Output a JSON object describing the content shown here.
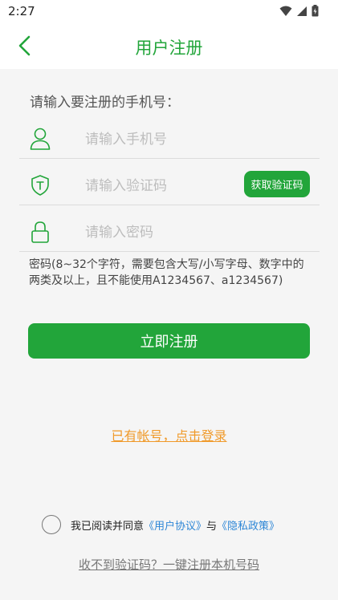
{
  "status_bar": {
    "time": "2:27"
  },
  "header": {
    "title": "用户注册"
  },
  "form": {
    "prompt": "请输入要注册的手机号：",
    "phone": {
      "placeholder": "请输入手机号",
      "value": ""
    },
    "code": {
      "placeholder": "请输入验证码",
      "value": "",
      "button_label": "获取验证码"
    },
    "password": {
      "placeholder": "请输入密码",
      "value": ""
    },
    "password_hint": "密码(8~32个字符，需要包含大写/小写字母、数字中的两类及以上，且不能使用A1234567、a1234567)",
    "register_label": "立即注册"
  },
  "login_link": "已有帐号，点击登录",
  "agreement": {
    "prefix": "我已阅读并同意",
    "user_agreement": "《用户协议》",
    "and": "与",
    "privacy_policy": "《隐私政策》"
  },
  "one_click_register": "收不到验证码？一键注册本机号码",
  "colors": {
    "brand_green": "#22a53a",
    "link_orange": "#f09a2a",
    "link_blue": "#2d86d6"
  }
}
